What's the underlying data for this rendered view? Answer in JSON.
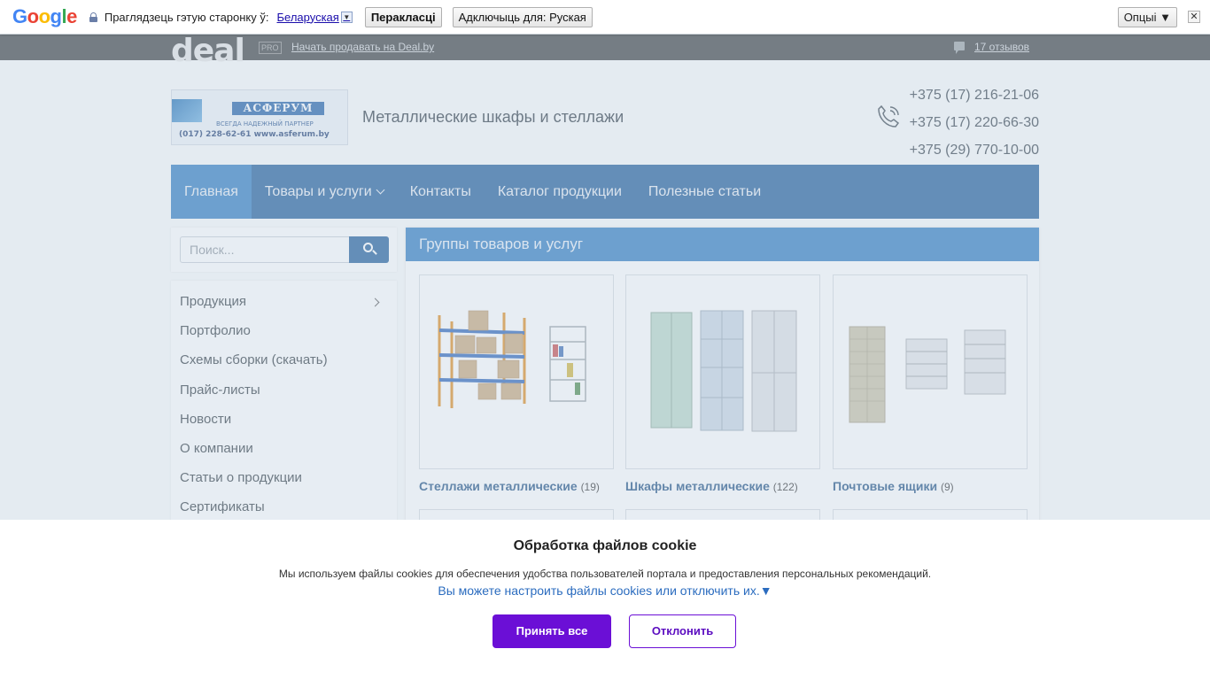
{
  "translate_bar": {
    "logo": "Google",
    "prompt": "Праглядзець гэтую старонку ў:",
    "language": "Беларуская",
    "translate_label": "Перакласці",
    "disable_label": "Адключыць для: Руская",
    "options_label": "Опцыі ▼",
    "close_symbol": "✕"
  },
  "deal_bar": {
    "logo": "deal",
    "pro_badge": "PRO",
    "sell_link": "Начать продавать на Deal.by",
    "reviews_link": "17 отзывов"
  },
  "header": {
    "banner": {
      "name": "АСФЕРУМ",
      "motto": "ВСЕГДА НАДЕЖНЫЙ ПАРТНЕР",
      "contact": "(017) 228-62-61  www.asferum.by"
    },
    "title": "Металлические шкафы и стеллажи",
    "phones": [
      "+375 (17) 216-21-06",
      "+375 (17) 220-66-30",
      "+375 (29) 770-10-00"
    ]
  },
  "nav": {
    "items": [
      {
        "label": "Главная"
      },
      {
        "label": "Товары и услуги"
      },
      {
        "label": "Контакты"
      },
      {
        "label": "Каталог продукции"
      },
      {
        "label": "Полезные статьи"
      }
    ]
  },
  "search": {
    "placeholder": "Поиск..."
  },
  "sidebar": {
    "items": [
      {
        "label": "Продукция"
      },
      {
        "label": "Портфолио"
      },
      {
        "label": "Схемы сборки (скачать)"
      },
      {
        "label": "Прайс-листы"
      },
      {
        "label": "Новости"
      },
      {
        "label": "О компании"
      },
      {
        "label": "Статьи о продукции"
      },
      {
        "label": "Сертификаты"
      }
    ]
  },
  "groups": {
    "title": "Группы товаров и услуг",
    "cards": [
      {
        "label": "Стеллажи металлические",
        "count": "(19)"
      },
      {
        "label": "Шкафы металлические",
        "count": "(122)"
      },
      {
        "label": "Почтовые ящики",
        "count": "(9)"
      }
    ]
  },
  "cookie": {
    "title": "Обработка файлов cookie",
    "text": "Мы используем файлы cookies для обеспечения удобства пользователей портала и предоставления персональных рекомендаций.",
    "link": "Вы можете настроить файлы cookies или отключить их.▼",
    "accept": "Принять все",
    "decline": "Отклонить"
  }
}
